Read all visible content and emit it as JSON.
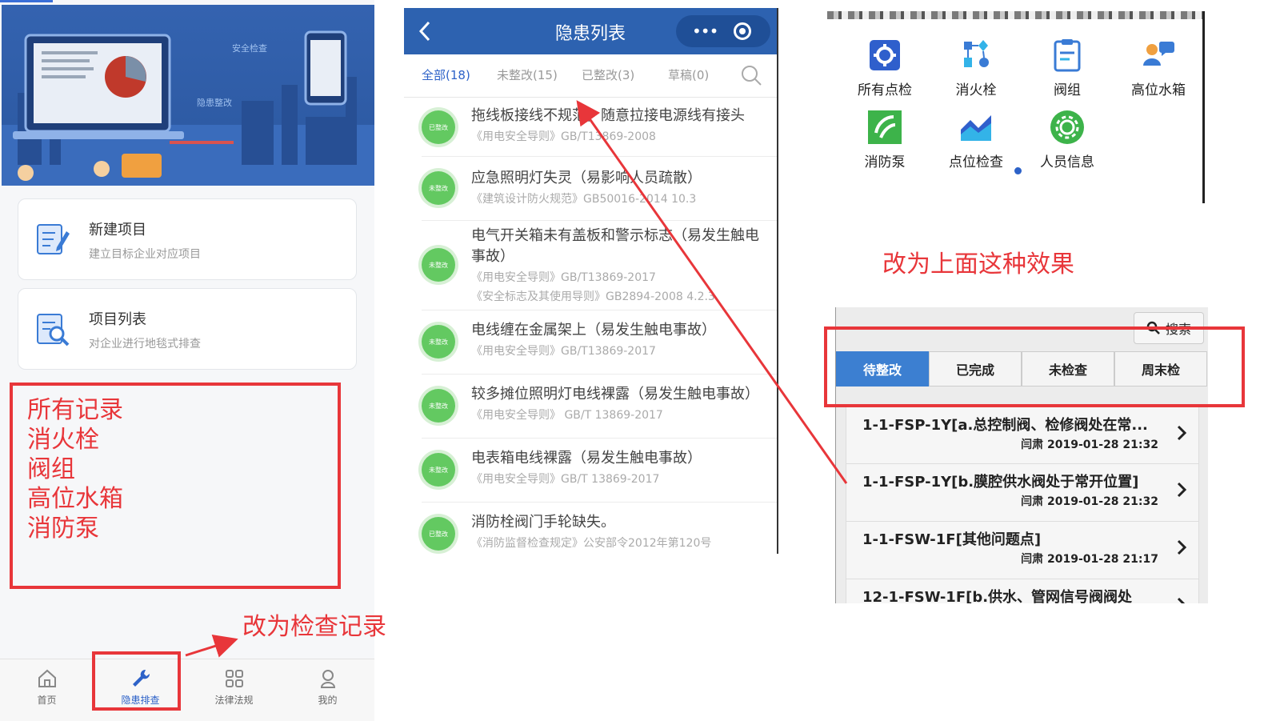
{
  "panel1": {
    "cards": [
      {
        "title": "新建项目",
        "subtitle": "建立目标企业对应项目",
        "icon": "edit-document-icon"
      },
      {
        "title": "项目列表",
        "subtitle": "对企业进行地毯式排查",
        "icon": "document-search-icon"
      }
    ],
    "annotation_list": [
      "所有记录",
      "消火栓",
      "阀组",
      "高位水箱",
      "消防泵"
    ],
    "tabbar": [
      {
        "label": "首页",
        "icon": "home-icon"
      },
      {
        "label": "隐患排查",
        "icon": "wrench-icon"
      },
      {
        "label": "法律法规",
        "icon": "grid-icon"
      },
      {
        "label": "我的",
        "icon": "user-icon"
      }
    ],
    "note": "改为检查记录"
  },
  "panel2": {
    "title": "隐患列表",
    "tabs": [
      "全部(18)",
      "未整改(15)",
      "已整改(3)",
      "草稿(0)"
    ],
    "items": [
      {
        "status": "已整改",
        "title": "拖线板接线不规范，随意拉接电源线有接头",
        "refs": [
          "《用电安全导则》GB/T13869-2008"
        ]
      },
      {
        "status": "未整改",
        "title": "应急照明灯失灵（易影响人员疏散）",
        "refs": [
          "《建筑设计防火规范》GB50016-2014 10.3"
        ]
      },
      {
        "status": "未整改",
        "title": "电气开关箱未有盖板和警示标志（易发生触电事故）",
        "refs": [
          "《用电安全导则》GB/T13869-2017",
          "《安全标志及其使用导则》GB2894-2008 4.2.3"
        ]
      },
      {
        "status": "未整改",
        "title": "电线缠在金属架上（易发生触电事故）",
        "refs": [
          "《用电安全导则》GB/T13869-2017"
        ]
      },
      {
        "status": "未整改",
        "title": "较多摊位照明灯电线裸露（易发生触电事故）",
        "refs": [
          "《用电安全导则》 GB/T 13869-2017"
        ]
      },
      {
        "status": "未整改",
        "title": "电表箱电线裸露（易发生触电事故）",
        "refs": [
          "《用电安全导则》GB/T 13869-2017"
        ]
      },
      {
        "status": "已整改",
        "title": "消防栓阀门手轮缺失。",
        "refs": [
          "《消防监督检查规定》公安部令2012年第120号"
        ]
      }
    ]
  },
  "panel3": {
    "grid": [
      {
        "label": "所有点检",
        "icon": "gear-icon",
        "color": "#2f5fcc"
      },
      {
        "label": "消火栓",
        "icon": "flow-icon",
        "color": "#3a7bd5"
      },
      {
        "label": "阀组",
        "icon": "clipboard-icon",
        "color": "#3a7bd5"
      },
      {
        "label": "高位水箱",
        "icon": "users-icon",
        "color": "#f0a040"
      },
      {
        "label": "消防泵",
        "icon": "check-leaf-icon",
        "color": "#3db34a"
      },
      {
        "label": "点位检查",
        "icon": "area-chart-icon",
        "color": "#2f5fcc"
      },
      {
        "label": "人员信息",
        "icon": "settings-circle-icon",
        "color": "#3db34a"
      }
    ],
    "note": "改为上面这种效果"
  },
  "panel4": {
    "search": "搜索",
    "segments": [
      "待整改",
      "已完成",
      "未检查",
      "周末检"
    ],
    "items": [
      {
        "title": "1-1-FSP-1Y[a.总控制阀、检修阀处在常...",
        "meta": "闫肃 2019-01-28 21:32"
      },
      {
        "title": "1-1-FSP-1Y[b.膜腔供水阀处于常开位置]",
        "meta": "闫肃 2019-01-28 21:32"
      },
      {
        "title": "1-1-FSW-1F[其他问题点]",
        "meta": "闫肃 2019-01-28 21:17"
      },
      {
        "title": "12-1-FSW-1F[b.供水、管网信号阀阀处",
        "meta": ""
      }
    ]
  },
  "colors": {
    "accent": "#2d62b0",
    "annotation_red": "#e8363a",
    "status_green": "#63c961"
  }
}
